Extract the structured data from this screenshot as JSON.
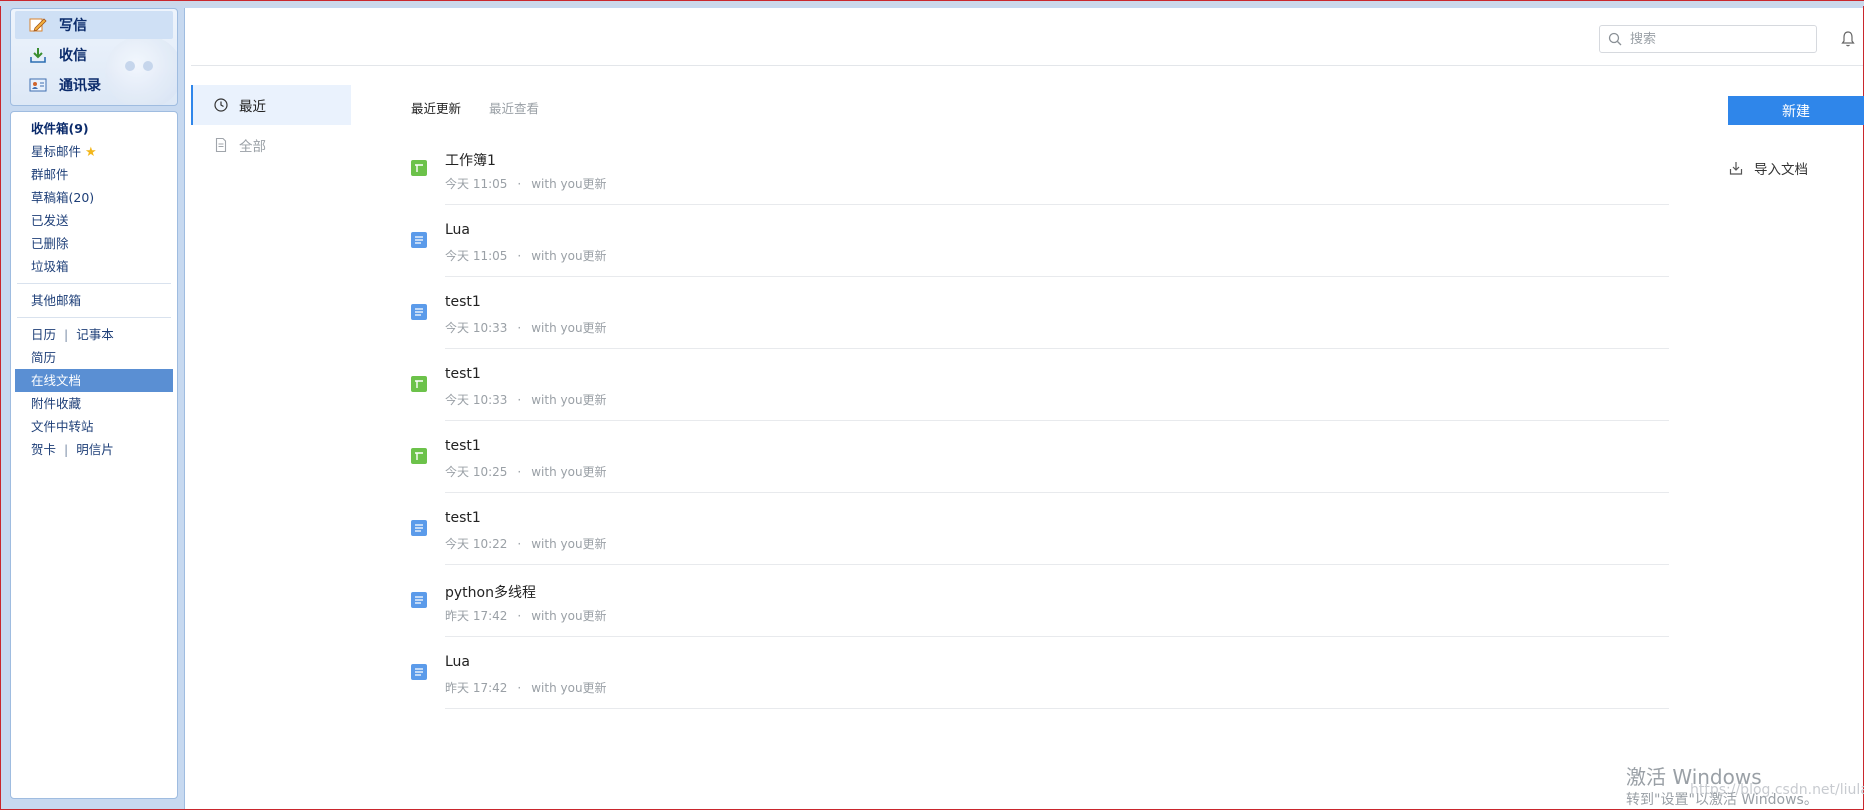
{
  "mail_nav": {
    "compose_label": "写信",
    "inbox_label": "收信",
    "contacts_label": "通讯录"
  },
  "folders": {
    "inbox": "收件箱(9)",
    "starred": "星标邮件",
    "group": "群邮件",
    "drafts": "草稿箱(20)",
    "sent": "已发送",
    "deleted": "已删除",
    "spam": "垃圾箱",
    "other_mailbox": "其他邮箱",
    "calendar": "日历",
    "notebook": "记事本",
    "resume": "简历",
    "online_docs": "在线文档",
    "attachments": "附件收藏",
    "file_transfer": "文件中转站",
    "greeting_card": "贺卡",
    "postcard": "明信片",
    "pipe": "|"
  },
  "header": {
    "search_placeholder": "搜索"
  },
  "left_tabs": {
    "recent": "最近",
    "all": "全部"
  },
  "sub_tabs": {
    "recently_updated": "最近更新",
    "recently_viewed": "最近查看"
  },
  "docs": [
    {
      "title": "工作簿1",
      "time": "今天 11:05",
      "dot": "·",
      "note": "with you更新",
      "type": "sheet"
    },
    {
      "title": "Lua",
      "time": "今天 11:05",
      "dot": "·",
      "note": "with you更新",
      "type": "doc"
    },
    {
      "title": "test1",
      "time": "今天 10:33",
      "dot": "·",
      "note": "with you更新",
      "type": "doc"
    },
    {
      "title": "test1",
      "time": "今天 10:33",
      "dot": "·",
      "note": "with you更新",
      "type": "sheet"
    },
    {
      "title": "test1",
      "time": "今天 10:25",
      "dot": "·",
      "note": "with you更新",
      "type": "sheet"
    },
    {
      "title": "test1",
      "time": "今天 10:22",
      "dot": "·",
      "note": "with you更新",
      "type": "doc"
    },
    {
      "title": "python多线程",
      "time": "昨天 17:42",
      "dot": "·",
      "note": "with you更新",
      "type": "doc"
    },
    {
      "title": "Lua",
      "time": "昨天 17:42",
      "dot": "·",
      "note": "with you更新",
      "type": "doc"
    }
  ],
  "actions": {
    "new_label": "新建",
    "import_label": "导入文档"
  },
  "watermark": {
    "line1": "激活 Windows",
    "line2": "转到\"设置\"以激活 Windows。",
    "url": "https://blog.csdn.net/liulanba"
  },
  "colors": {
    "accent": "#2f86ea",
    "sheet_icon": "#6cc24a",
    "doc_icon": "#5b9bea",
    "selected_nav": "#5a8fd3"
  }
}
